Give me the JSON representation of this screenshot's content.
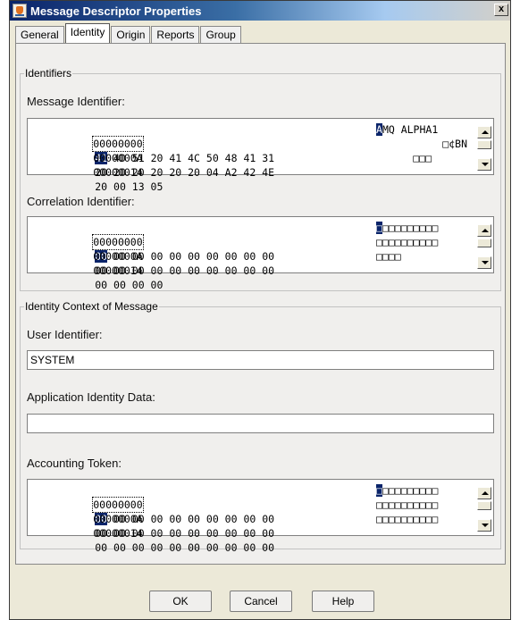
{
  "window": {
    "title": "Message Descriptor Properties",
    "close_glyph": "x"
  },
  "tabs": [
    {
      "label": "General"
    },
    {
      "label": "Identity"
    },
    {
      "label": "Origin"
    },
    {
      "label": "Reports"
    },
    {
      "label": "Group"
    }
  ],
  "identifiers": {
    "legend": "Identifiers",
    "message": {
      "label": "Message Identifier:",
      "rows": [
        {
          "offset": "00000000",
          "first": "41",
          "bytes": "4D 51 20 41 4C 50 48 41 31",
          "ascii_first": "A",
          "ascii": "MQ ALPHA1"
        },
        {
          "offset": "0000000A",
          "bytes": "20 20 20 20 20 20 04 A2 42 4E",
          "ascii": "□¢BN"
        },
        {
          "offset": "00000014",
          "bytes": "20 00 13 05",
          "ascii": "□□□"
        }
      ]
    },
    "correlation": {
      "label": "Correlation Identifier:",
      "rows": [
        {
          "offset": "00000000",
          "first": "00",
          "bytes": "00 00 00 00 00 00 00 00 00",
          "ascii_first": "□",
          "ascii": "□□□□□□□□□"
        },
        {
          "offset": "0000000A",
          "bytes": "00 00 00 00 00 00 00 00 00 00",
          "ascii": "□□□□□□□□□□"
        },
        {
          "offset": "00000014",
          "bytes": "00 00 00 00",
          "ascii": "□□□□"
        }
      ]
    }
  },
  "identity_context": {
    "legend": "Identity Context of Message",
    "user_identifier": {
      "label": "User Identifier:",
      "value": "SYSTEM"
    },
    "application_identity": {
      "label": "Application Identity Data:",
      "value": ""
    },
    "accounting_token": {
      "label": "Accounting Token:",
      "rows": [
        {
          "offset": "00000000",
          "first": "00",
          "bytes": "00 00 00 00 00 00 00 00 00",
          "ascii_first": "□",
          "ascii": "□□□□□□□□□"
        },
        {
          "offset": "0000000A",
          "bytes": "00 00 00 00 00 00 00 00 00 00",
          "ascii": "□□□□□□□□□□"
        },
        {
          "offset": "00000014",
          "bytes": "00 00 00 00 00 00 00 00 00 00",
          "ascii": "□□□□□□□□□□"
        }
      ]
    }
  },
  "buttons": {
    "ok": "OK",
    "cancel": "Cancel",
    "help": "Help"
  },
  "colors": {
    "title_bar": "#0a246a",
    "selection": "#0a246a",
    "dialog_bg": "#f0efed"
  },
  "icons": [
    "java-cup-icon",
    "close-icon",
    "scroll-up-icon",
    "scroll-down-icon"
  ]
}
